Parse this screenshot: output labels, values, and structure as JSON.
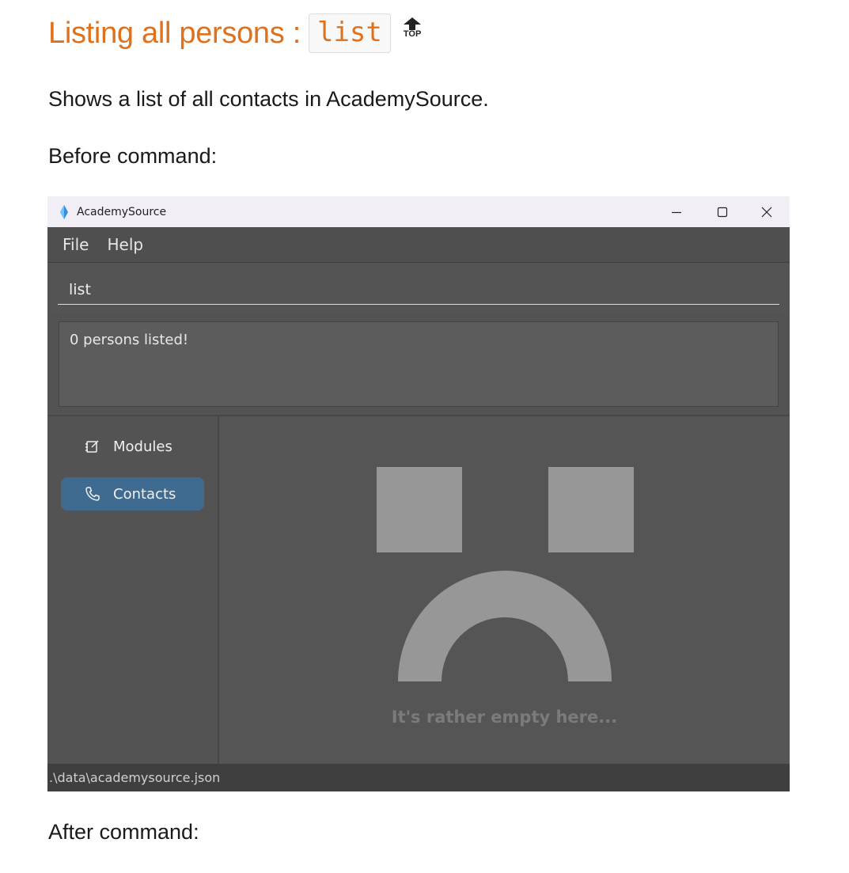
{
  "doc": {
    "heading": "Listing all persons :",
    "heading_code": "list",
    "top_label": "TOP",
    "description": "Shows a list of all contacts in AcademySource.",
    "before_label": "Before command:",
    "after_label": "After command:"
  },
  "app": {
    "title": "AcademySource",
    "window_controls": [
      "minimize-icon",
      "maximize-icon",
      "close-icon"
    ],
    "menu": [
      "File",
      "Help"
    ],
    "command_value": "list",
    "result_text": "0 persons listed!",
    "nav": [
      {
        "label": "Modules",
        "icon": "edit-note-icon",
        "active": false
      },
      {
        "label": "Contacts",
        "icon": "phone-icon",
        "active": true
      }
    ],
    "empty_message": "It's rather empty here...",
    "status_path": ".\\data\\academysource.json"
  },
  "colors": {
    "heading_orange": "#e0711c",
    "app_bg": "#535353",
    "nav_active": "#3f6b90",
    "empty_face": "#979797"
  }
}
